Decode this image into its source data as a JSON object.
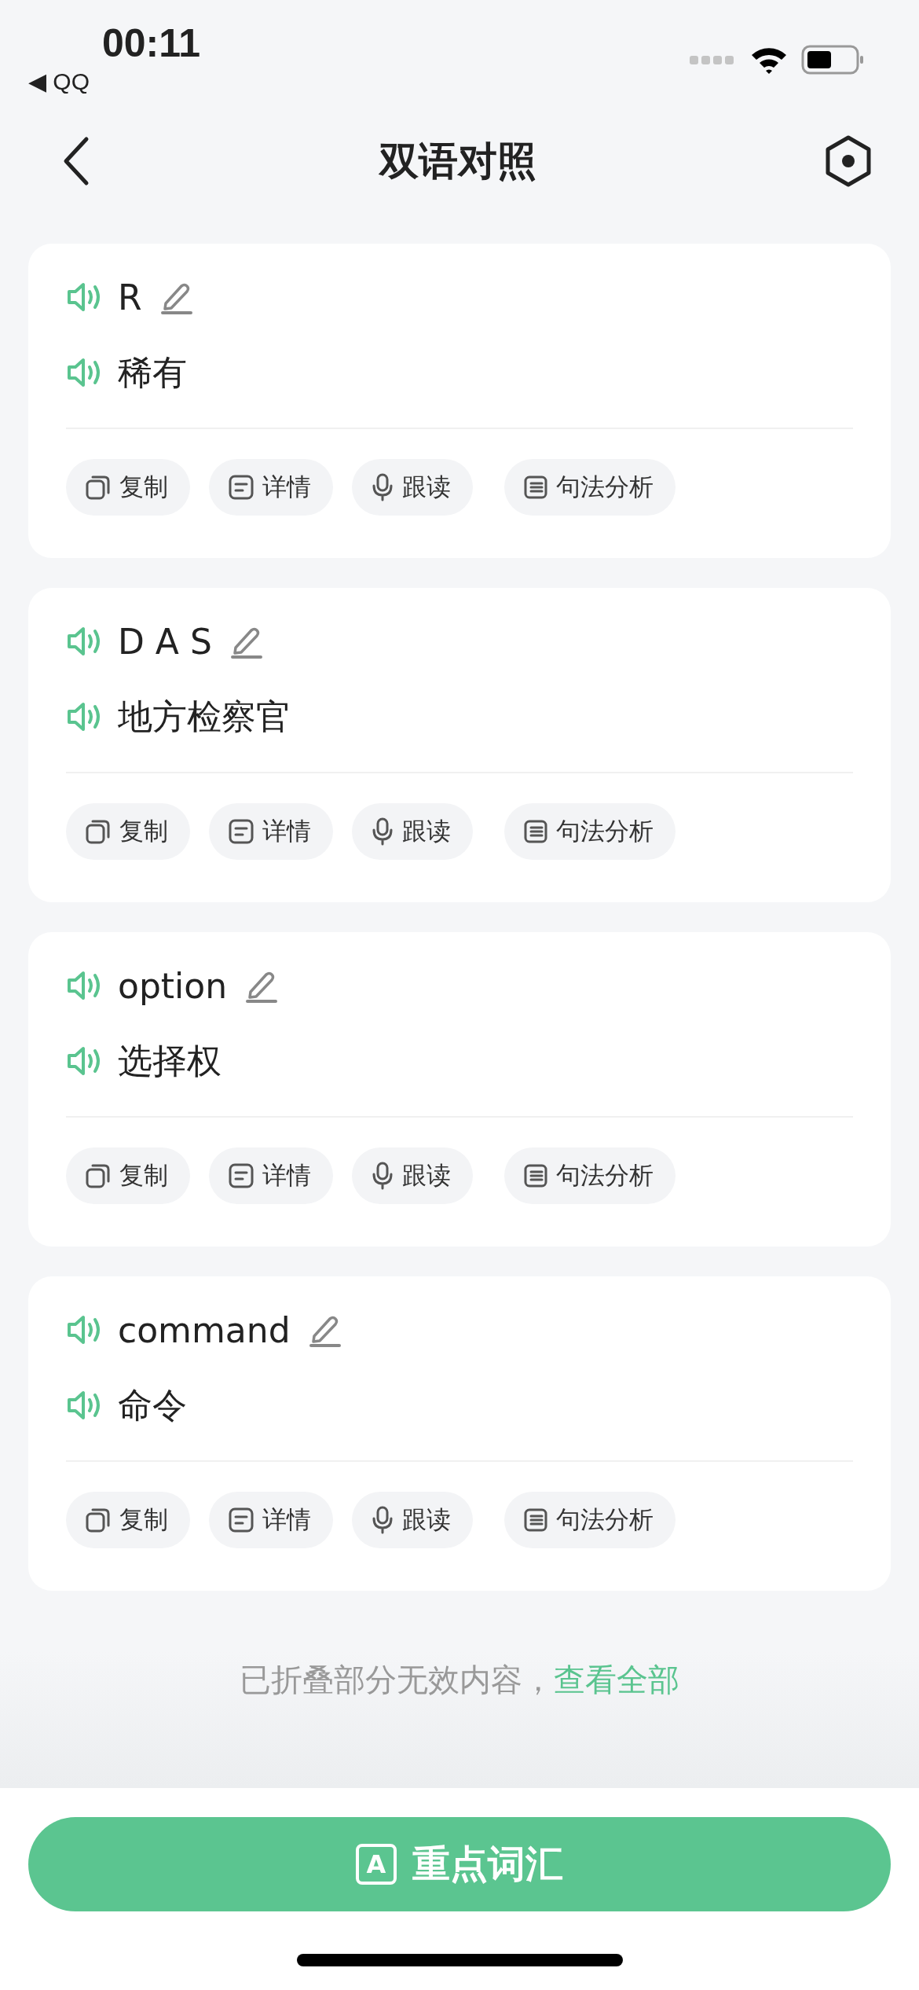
{
  "status_bar": {
    "time": "00:11",
    "back_app": "◀ QQ"
  },
  "nav": {
    "title": "双语对照"
  },
  "entries": [
    {
      "source": "R",
      "translation": "稀有",
      "actions": [
        "复制",
        "详情",
        "跟读",
        "句法分析"
      ]
    },
    {
      "source": "D A S",
      "translation": "地方检察官",
      "actions": [
        "复制",
        "详情",
        "跟读",
        "句法分析"
      ]
    },
    {
      "source": "option",
      "translation": "选择权",
      "actions": [
        "复制",
        "详情",
        "跟读",
        "句法分析"
      ]
    },
    {
      "source": "command",
      "translation": "命令",
      "actions": [
        "复制",
        "详情",
        "跟读",
        "句法分析"
      ]
    }
  ],
  "folded_note": {
    "text": "已折叠部分无效内容，",
    "link": "查看全部"
  },
  "primary_button": {
    "icon_letter": "A",
    "label": "重点词汇"
  }
}
